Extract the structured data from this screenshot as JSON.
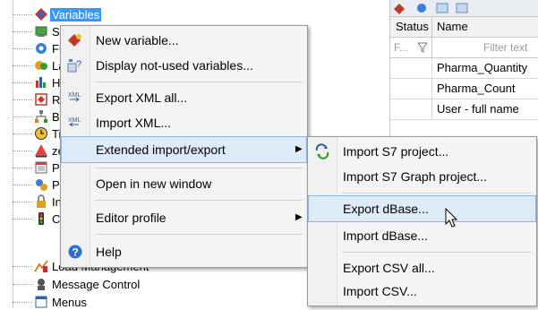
{
  "tree": {
    "items": [
      {
        "label": "Variables",
        "icon": "variables-icon",
        "selected": true
      },
      {
        "label": "Scr",
        "icon": "screens-icon"
      },
      {
        "label": "Fun",
        "icon": "functions-icon"
      },
      {
        "label": "Lan",
        "icon": "language-icon"
      },
      {
        "label": "Hist",
        "icon": "historian-icon"
      },
      {
        "label": "Rec",
        "icon": "recipes-icon"
      },
      {
        "label": "Bat",
        "icon": "batch-icon"
      },
      {
        "label": "Tim",
        "icon": "timer-icon"
      },
      {
        "label": "zen",
        "icon": "zenon-icon"
      },
      {
        "label": "Pro",
        "icon": "process-icon"
      },
      {
        "label": "Pro",
        "icon": "project-icon"
      },
      {
        "label": "Inte",
        "icon": "interlocking-icon"
      },
      {
        "label": "Con",
        "icon": "command-icon"
      },
      {
        "label": "Load Management",
        "icon": "load-management-icon"
      },
      {
        "label": "Message Control",
        "icon": "message-control-icon"
      },
      {
        "label": "Menus",
        "icon": "menus-icon"
      }
    ]
  },
  "grid": {
    "headers": {
      "status": "Status",
      "name": "Name"
    },
    "filter": {
      "status": "F...",
      "name": "Filter text"
    },
    "rows": [
      "Pharma_Quantity",
      "Pharma_Count",
      "User - full name"
    ]
  },
  "context_menu": {
    "items": [
      {
        "label": "New variable...",
        "icon": "new-variable-icon"
      },
      {
        "label": "Display not-used variables...",
        "icon": "unused-variables-icon"
      },
      {
        "label": "Export XML all...",
        "icon": "export-xml-icon"
      },
      {
        "label": "Import XML...",
        "icon": "import-xml-icon"
      },
      {
        "label": "Extended import/export",
        "icon": "",
        "submenu": true,
        "highlighted": true
      },
      {
        "label": "Open in new window",
        "icon": ""
      },
      {
        "label": "Editor profile",
        "icon": "",
        "submenu": true
      },
      {
        "label": "Help",
        "icon": "help-icon"
      }
    ]
  },
  "submenu": {
    "items": [
      {
        "label": "Import S7 project...",
        "icon": "import-s7-icon"
      },
      {
        "label": "Import S7 Graph project...",
        "icon": ""
      },
      {
        "label": "Export dBase...",
        "icon": "",
        "highlighted": true
      },
      {
        "label": "Import dBase...",
        "icon": ""
      },
      {
        "label": "Export CSV all...",
        "icon": ""
      },
      {
        "label": "Import CSV...",
        "icon": ""
      }
    ]
  },
  "colors": {
    "selection": "#3399ff",
    "menu_highlight": "#ddeaf7",
    "menu_bg": "#f5f5f5"
  }
}
